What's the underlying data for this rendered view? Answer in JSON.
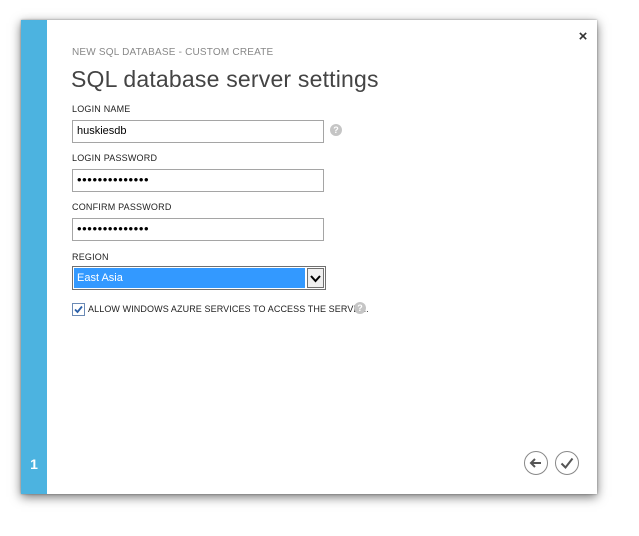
{
  "wizard": {
    "step_number": "1",
    "close_label": "×",
    "subtitle": "NEW SQL DATABASE - CUSTOM CREATE",
    "title": "SQL database server settings"
  },
  "form": {
    "login_name": {
      "label": "LOGIN NAME",
      "value": "huskiesdb"
    },
    "login_password": {
      "label": "LOGIN PASSWORD",
      "value": "••••••••••••••"
    },
    "confirm_password": {
      "label": "CONFIRM PASSWORD",
      "value": "••••••••••••••"
    },
    "region": {
      "label": "REGION",
      "selected": "East Asia"
    },
    "allow_azure": {
      "label": "ALLOW WINDOWS AZURE SERVICES TO ACCESS THE SERVER.",
      "checked": true
    },
    "help_symbol": "?"
  },
  "colors": {
    "step_bar": "#4cb3e0",
    "select_highlight": "#3399ff"
  },
  "icons": {
    "back": "back-arrow-icon",
    "complete": "checkmark-icon",
    "help": "help-icon",
    "close": "close-icon"
  }
}
